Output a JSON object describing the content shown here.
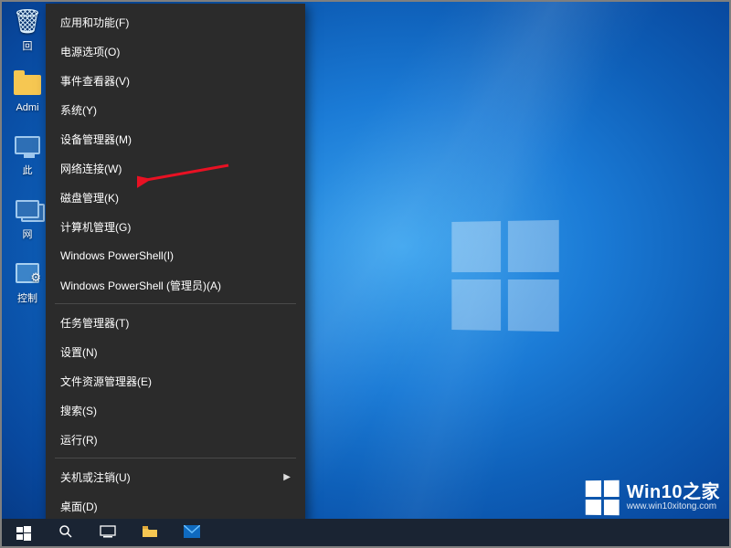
{
  "desktop": {
    "icons": [
      {
        "label": "回",
        "kind": "bin"
      },
      {
        "label": "Admi",
        "kind": "folder"
      },
      {
        "label": "此",
        "kind": "pc"
      },
      {
        "label": "网",
        "kind": "net"
      },
      {
        "label": "控制",
        "kind": "panel"
      }
    ]
  },
  "menu": {
    "groups": [
      [
        {
          "label": "应用和功能(F)"
        },
        {
          "label": "电源选项(O)"
        },
        {
          "label": "事件查看器(V)"
        },
        {
          "label": "系统(Y)"
        },
        {
          "label": "设备管理器(M)"
        },
        {
          "label": "网络连接(W)"
        },
        {
          "label": "磁盘管理(K)"
        },
        {
          "label": "计算机管理(G)"
        },
        {
          "label": "Windows PowerShell(I)"
        },
        {
          "label": "Windows PowerShell (管理员)(A)"
        }
      ],
      [
        {
          "label": "任务管理器(T)"
        },
        {
          "label": "设置(N)"
        },
        {
          "label": "文件资源管理器(E)"
        },
        {
          "label": "搜索(S)"
        },
        {
          "label": "运行(R)"
        }
      ],
      [
        {
          "label": "关机或注销(U)",
          "submenu": true
        },
        {
          "label": "桌面(D)"
        }
      ]
    ]
  },
  "annotation": {
    "target_label": "网络连接(W)"
  },
  "taskbar": {
    "buttons": [
      "start",
      "search",
      "taskview",
      "explorer",
      "mail"
    ]
  },
  "watermark": {
    "title": "Win10之家",
    "subtitle": "www.win10xitong.com"
  }
}
